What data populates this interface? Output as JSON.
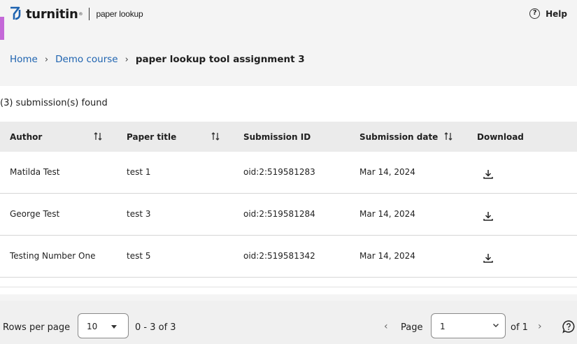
{
  "header": {
    "brand_name": "turnitin",
    "brand_tm": "®",
    "product_name": "paper lookup",
    "help_label": "Help",
    "accent_color": "#c468d8",
    "brand_color": "#1e63b0"
  },
  "breadcrumb": {
    "home": "Home",
    "course": "Demo course",
    "current": "paper lookup tool assignment 3"
  },
  "results": {
    "count_text": "(3) submission(s) found"
  },
  "table": {
    "columns": [
      "Author",
      "Paper title",
      "Submission ID",
      "Submission date",
      "Download"
    ],
    "rows": [
      {
        "author": "Matilda Test",
        "title": "test 1",
        "id": "oid:2:519581283",
        "date": "Mar 14, 2024"
      },
      {
        "author": "George Test",
        "title": "test 3",
        "id": "oid:2:519581284",
        "date": "Mar 14, 2024"
      },
      {
        "author": "Testing Number One",
        "title": "test 5",
        "id": "oid:2:519581342",
        "date": "Mar 14, 2024"
      }
    ]
  },
  "pagination": {
    "rows_per_page_label": "Rows per page",
    "rows_per_page_value": "10",
    "range_text": "0 - 3 of 3",
    "page_label": "Page",
    "page_value": "1",
    "of_text": "of 1"
  },
  "icons": {
    "sort": "sort-arrows-icon",
    "download": "download-icon",
    "help": "help-circle-icon",
    "chat": "chat-help-icon"
  }
}
